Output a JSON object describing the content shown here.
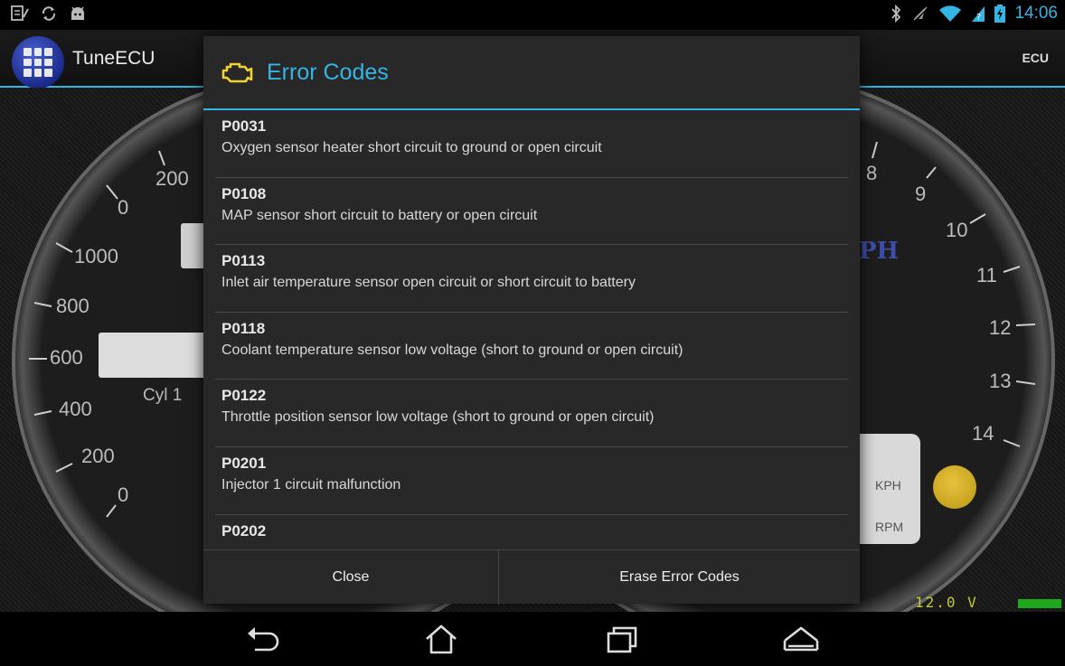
{
  "status_bar": {
    "time": "14:06"
  },
  "action_bar": {
    "app_title": "TuneECU",
    "ecu_label": "ECU"
  },
  "dashboard": {
    "left_gauge_labels": [
      "200",
      "0",
      "1000",
      "800",
      "600",
      "400",
      "200",
      "0"
    ],
    "right_gauge_labels": [
      "8",
      "9",
      "10",
      "11",
      "12",
      "13",
      "14"
    ],
    "cyl_label": "Cyl 1",
    "kph_label": "KPH",
    "rpm_label": "RPM",
    "mph_logo": "PH",
    "voltage": "12.0 V"
  },
  "dialog": {
    "title": "Error Codes",
    "codes": [
      {
        "code": "P0031",
        "description": "Oxygen sensor heater short circuit to ground or open circuit"
      },
      {
        "code": "P0108",
        "description": "MAP sensor short circuit to battery or open circuit"
      },
      {
        "code": "P0113",
        "description": "Inlet air temperature sensor open circuit or short circuit to battery"
      },
      {
        "code": "P0118",
        "description": "Coolant temperature sensor low voltage (short to ground or open circuit)"
      },
      {
        "code": "P0122",
        "description": "Throttle position sensor low voltage (short to ground or open circuit)"
      },
      {
        "code": "P0201",
        "description": "Injector 1 circuit malfunction"
      },
      {
        "code": "P0202",
        "description": ""
      }
    ],
    "close_label": "Close",
    "erase_label": "Erase Error Codes"
  },
  "colors": {
    "accent": "#33b5e5",
    "engine_icon": "#f2d22e"
  }
}
